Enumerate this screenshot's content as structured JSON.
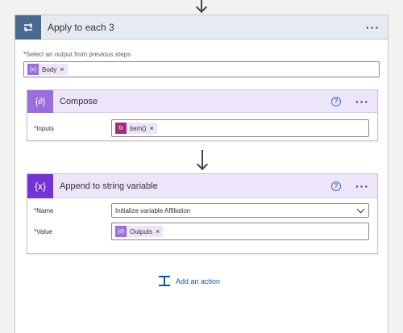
{
  "outer": {
    "title": "Apply to each 3",
    "select_label": "Select an output from previous steps",
    "select_token": "Body"
  },
  "compose": {
    "title": "Compose",
    "inputs_label": "Inputs",
    "inputs_token": "item()"
  },
  "append": {
    "title": "Append to string variable",
    "name_label": "Name",
    "name_value": "Initialize variable Affiliation",
    "value_label": "Value",
    "value_token": "Outputs"
  },
  "add_action": "Add an action",
  "required_mark": "*",
  "colors": {
    "loop_header": "#486991",
    "compose_icon": "#9a6ddb",
    "append_icon": "#7433d4",
    "expression_token": "#a0307f",
    "variable_token": "#9a6ddb",
    "link": "#0f5a9c"
  },
  "icons": [
    "loop-icon",
    "compose-icon",
    "variable-icon",
    "help-icon",
    "more-icon",
    "close-icon",
    "add-action-icon",
    "chevron-down-icon",
    "down-arrow-icon"
  ]
}
